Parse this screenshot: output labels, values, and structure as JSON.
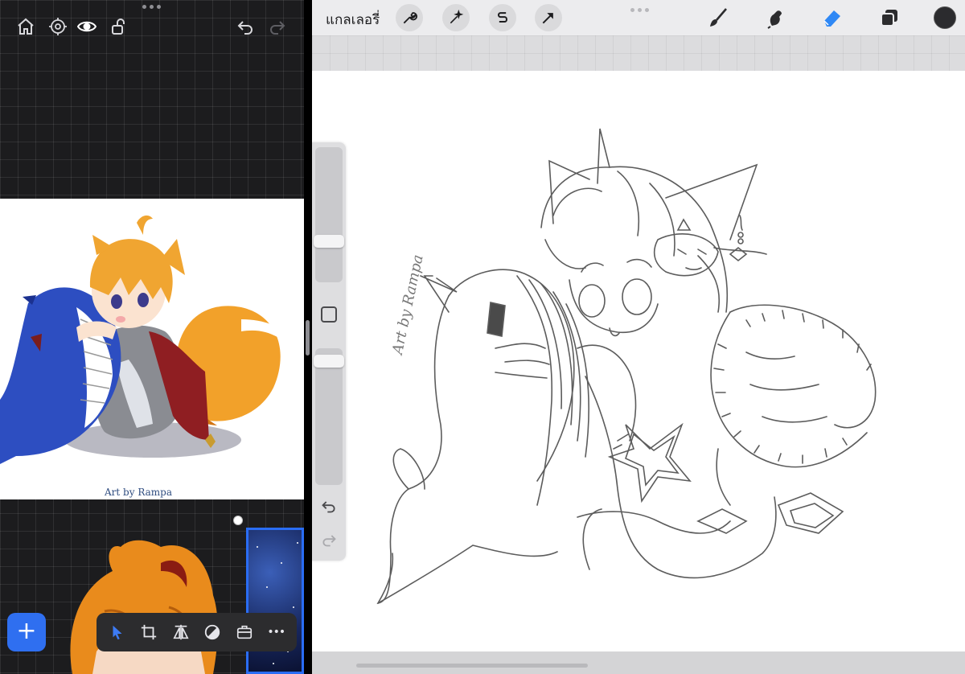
{
  "reference_app": {
    "toolbar": {
      "home_icon": "home-icon",
      "settings_icon": "gear-icon",
      "view_icon": "eye-icon",
      "lock_icon": "unlock-icon",
      "undo_icon": "undo-icon",
      "redo_icon": "redo-icon"
    },
    "reference_image": {
      "caption": "Art by Rampa"
    },
    "add_button_label": "+",
    "bottom_toolbar": {
      "items": [
        "select-arrow-icon",
        "crop-icon",
        "flip-icon",
        "adjustments-icon",
        "briefcase-icon",
        "more-icon"
      ],
      "more_label": "•••"
    }
  },
  "drawing_app": {
    "top_bar": {
      "gallery_label": "แกลเลอรี่",
      "left_tools": [
        "wrench-icon",
        "magic-wand-icon",
        "selection-s-icon",
        "transform-arrow-icon"
      ],
      "right_tools": [
        "brush-icon",
        "smudge-icon",
        "eraser-icon",
        "layers-icon",
        "color-swatch"
      ],
      "active_tool": "eraser-icon",
      "accent_color": "#2f88f5",
      "current_color": "#2b2b2e"
    },
    "sidebar": {
      "brush_size_level": 0.28,
      "opacity_level": 0.05,
      "undo_icon": "undo-icon",
      "redo_icon": "redo-icon"
    },
    "canvas": {
      "signature": "Art by Rampa"
    }
  }
}
